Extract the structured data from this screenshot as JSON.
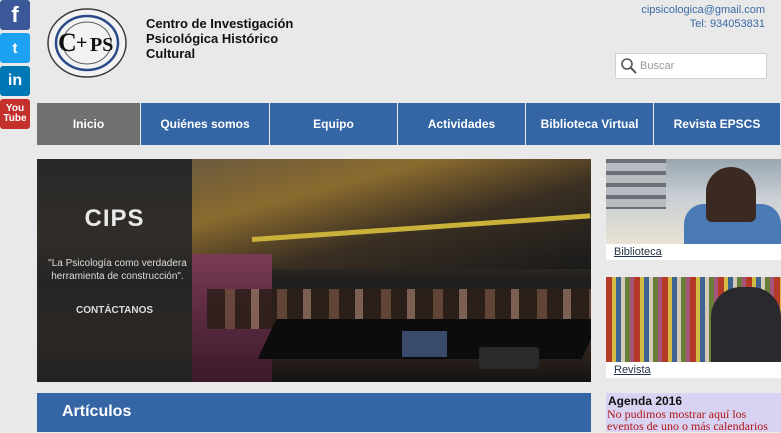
{
  "social": {
    "facebook": {
      "icon": "facebook-icon",
      "glyph": "f"
    },
    "twitter": {
      "icon": "twitter-icon",
      "glyph": "t"
    },
    "linkedin": {
      "icon": "linkedin-icon",
      "glyph": "in"
    },
    "youtube": {
      "icon": "youtube-icon",
      "line1": "You",
      "line2": "Tube"
    }
  },
  "logo": {
    "text": "C+PS",
    "subtext": "Centro de Investigación Psicológica Histórico Cultural"
  },
  "org_name": "Centro de Investigación Psicológica Histórico Cultural",
  "contact": {
    "email": "cipsicologica@gmail.com",
    "phone": "Tel: 934053831"
  },
  "search": {
    "placeholder": "Buscar"
  },
  "nav": {
    "items": [
      {
        "label": "Inicio"
      },
      {
        "label": "Quiénes somos"
      },
      {
        "label": "Equipo"
      },
      {
        "label": "Actividades"
      },
      {
        "label": "Biblioteca Virtual"
      },
      {
        "label": "Revista EPSCS"
      }
    ],
    "active_color": "#707070",
    "color": "#3465a4"
  },
  "slider": {
    "title": "CIPS",
    "quote": "\"La Psicología como verdadera herramienta de construcción\".",
    "cta": "CONTÁCTANOS"
  },
  "cards": [
    {
      "label": "Biblioteca"
    },
    {
      "label": "Revista"
    }
  ],
  "articles": {
    "title": "Artículos"
  },
  "agenda": {
    "title": "Agenda 2016",
    "message": "No pudimos mostrar aquí los eventos de uno o más calendarios"
  }
}
